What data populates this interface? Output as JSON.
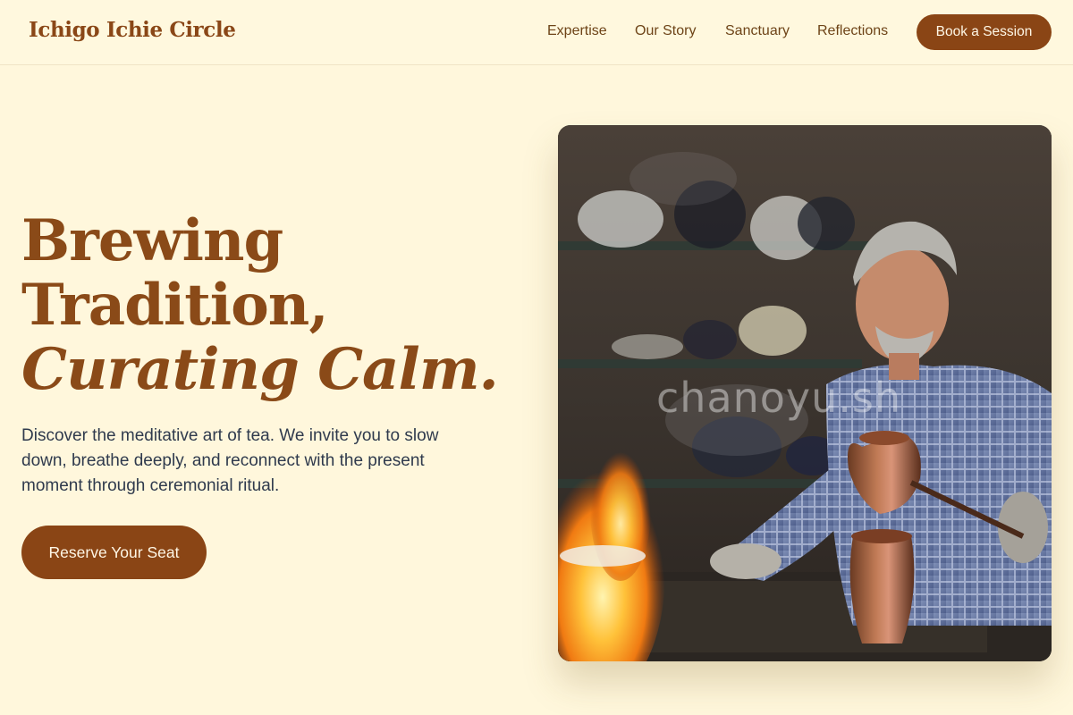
{
  "header": {
    "brand": "Ichigo Ichie Circle",
    "nav": [
      "Expertise",
      "Our Story",
      "Sanctuary",
      "Reflections"
    ],
    "cta_label": "Book a Session"
  },
  "hero": {
    "headline_line1": "Brewing",
    "headline_line2": "Tradition,",
    "headline_line3": "Curating Calm.",
    "description": "Discover the meditative art of tea. We invite you to slow down, breathe deeply, and reconnect with the present moment through ceremonial ritual.",
    "cta_label": "Reserve Your Seat",
    "image_watermark": "chanoyu.sh"
  },
  "colors": {
    "background": "#fff7dc",
    "accent": "#8a4515",
    "heading": "#8a4a18",
    "body_text": "#2f3a4d"
  }
}
